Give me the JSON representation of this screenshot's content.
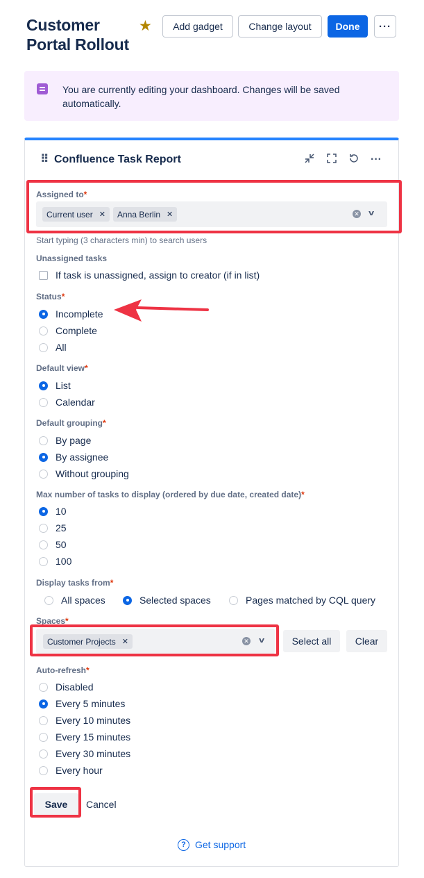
{
  "header": {
    "title": "Customer Portal Rollout",
    "star_icon": "star-icon",
    "add_gadget": "Add gadget",
    "change_layout": "Change layout",
    "done": "Done",
    "more": "···"
  },
  "banner": {
    "text": "You are currently editing your dashboard. Changes will be saved automatically."
  },
  "gadget": {
    "title": "Confluence Task Report",
    "icons": [
      "minimize-icon",
      "fullscreen-icon",
      "refresh-icon",
      "more-icon"
    ],
    "assigned_to": {
      "label": "Assigned to",
      "tags": [
        "Current user",
        "Anna Berlin"
      ],
      "helper": "Start typing (3 characters min) to search users"
    },
    "unassigned": {
      "label": "Unassigned tasks",
      "checkbox": "If task is unassigned, assign to creator (if in list)"
    },
    "status": {
      "label": "Status",
      "options": [
        "Incomplete",
        "Complete",
        "All"
      ],
      "selected": "Incomplete"
    },
    "default_view": {
      "label": "Default view",
      "options": [
        "List",
        "Calendar"
      ],
      "selected": "List"
    },
    "default_grouping": {
      "label": "Default grouping",
      "options": [
        "By page",
        "By assignee",
        "Without grouping"
      ],
      "selected": "By assignee"
    },
    "max_tasks": {
      "label": "Max number of tasks to display (ordered by due date, created date)",
      "options": [
        "10",
        "25",
        "50",
        "100"
      ],
      "selected": "10"
    },
    "display_from": {
      "label": "Display tasks from",
      "options": [
        "All spaces",
        "Selected spaces",
        "Pages matched by CQL query"
      ],
      "selected": "Selected spaces"
    },
    "spaces": {
      "label": "Spaces",
      "tags": [
        "Customer Projects"
      ],
      "select_all": "Select all",
      "clear": "Clear"
    },
    "auto_refresh": {
      "label": "Auto-refresh",
      "options": [
        "Disabled",
        "Every 5 minutes",
        "Every 10 minutes",
        "Every 15 minutes",
        "Every 30 minutes",
        "Every hour"
      ],
      "selected": "Every 5 minutes"
    },
    "save": "Save",
    "cancel": "Cancel",
    "support": "Get support",
    "required_mark": "*"
  },
  "colors": {
    "primary": "#0c66e4",
    "banner_bg": "#f8eefe",
    "annotation_red": "#ee3344",
    "star": "#b38600"
  }
}
